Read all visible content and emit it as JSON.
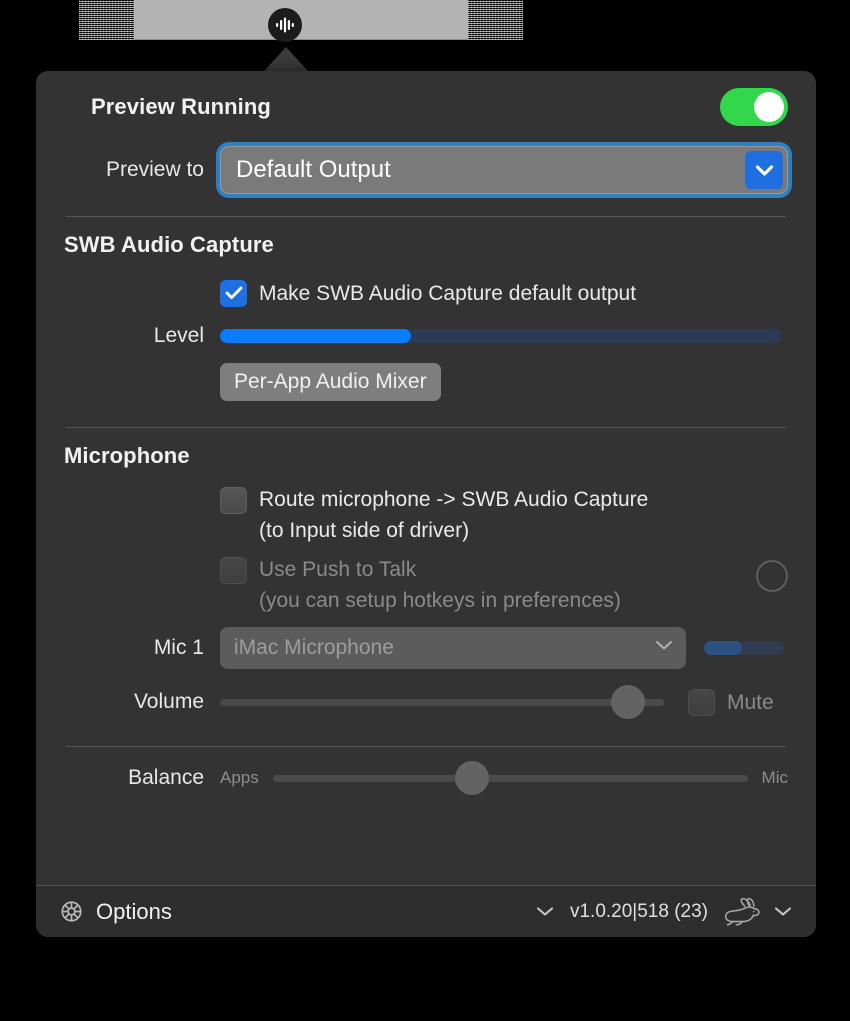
{
  "menubar": {
    "status_icon": "audio-waveform-icon"
  },
  "panel": {
    "preview": {
      "title": "Preview Running",
      "toggle_state": "on",
      "toggle_color": "#32d74b",
      "field_label": "Preview to",
      "selected_output": "Default Output",
      "chevron_icon": "chevron-down-icon",
      "focus_ring_color": "#2f7fc2"
    },
    "swb_capture": {
      "title": "SWB Audio Capture",
      "default_output_checkbox": {
        "label": "Make SWB Audio Capture default output",
        "checked": true,
        "color": "#1f6fe0"
      },
      "level": {
        "label": "Level",
        "percent": 34,
        "fill_color": "#0a7cff",
        "track_color": "#2b3a55"
      },
      "mixer_button": "Per-App Audio Mixer"
    },
    "microphone": {
      "title": "Microphone",
      "route_checkbox": {
        "label_line1": "Route microphone -> SWB Audio Capture",
        "label_line2": "(to Input side of driver)",
        "checked": false
      },
      "push_to_talk": {
        "label_line1": "Use Push to Talk",
        "label_line2": "(you can setup hotkeys in preferences)",
        "checked": false,
        "disabled": true,
        "indicator_icon": "ptt-status-circle-icon"
      },
      "mic1": {
        "label": "Mic 1",
        "selected_device": "iMac Microphone",
        "disabled": true,
        "chevron_icon": "chevron-down-icon",
        "meter_percent": 48
      },
      "volume": {
        "label": "Volume",
        "percent": 92,
        "mute_label": "Mute",
        "mute_checked": false
      },
      "balance": {
        "label": "Balance",
        "left_label": "Apps",
        "right_label": "Mic",
        "percent": 42
      }
    }
  },
  "footer": {
    "gear_icon": "gear-icon",
    "options_label": "Options",
    "options_chevron_icon": "chevron-down-icon",
    "version": "v1.0.20|518 (23)",
    "brand_icon": "rabbit-icon",
    "brand_chevron_icon": "chevron-down-icon"
  }
}
